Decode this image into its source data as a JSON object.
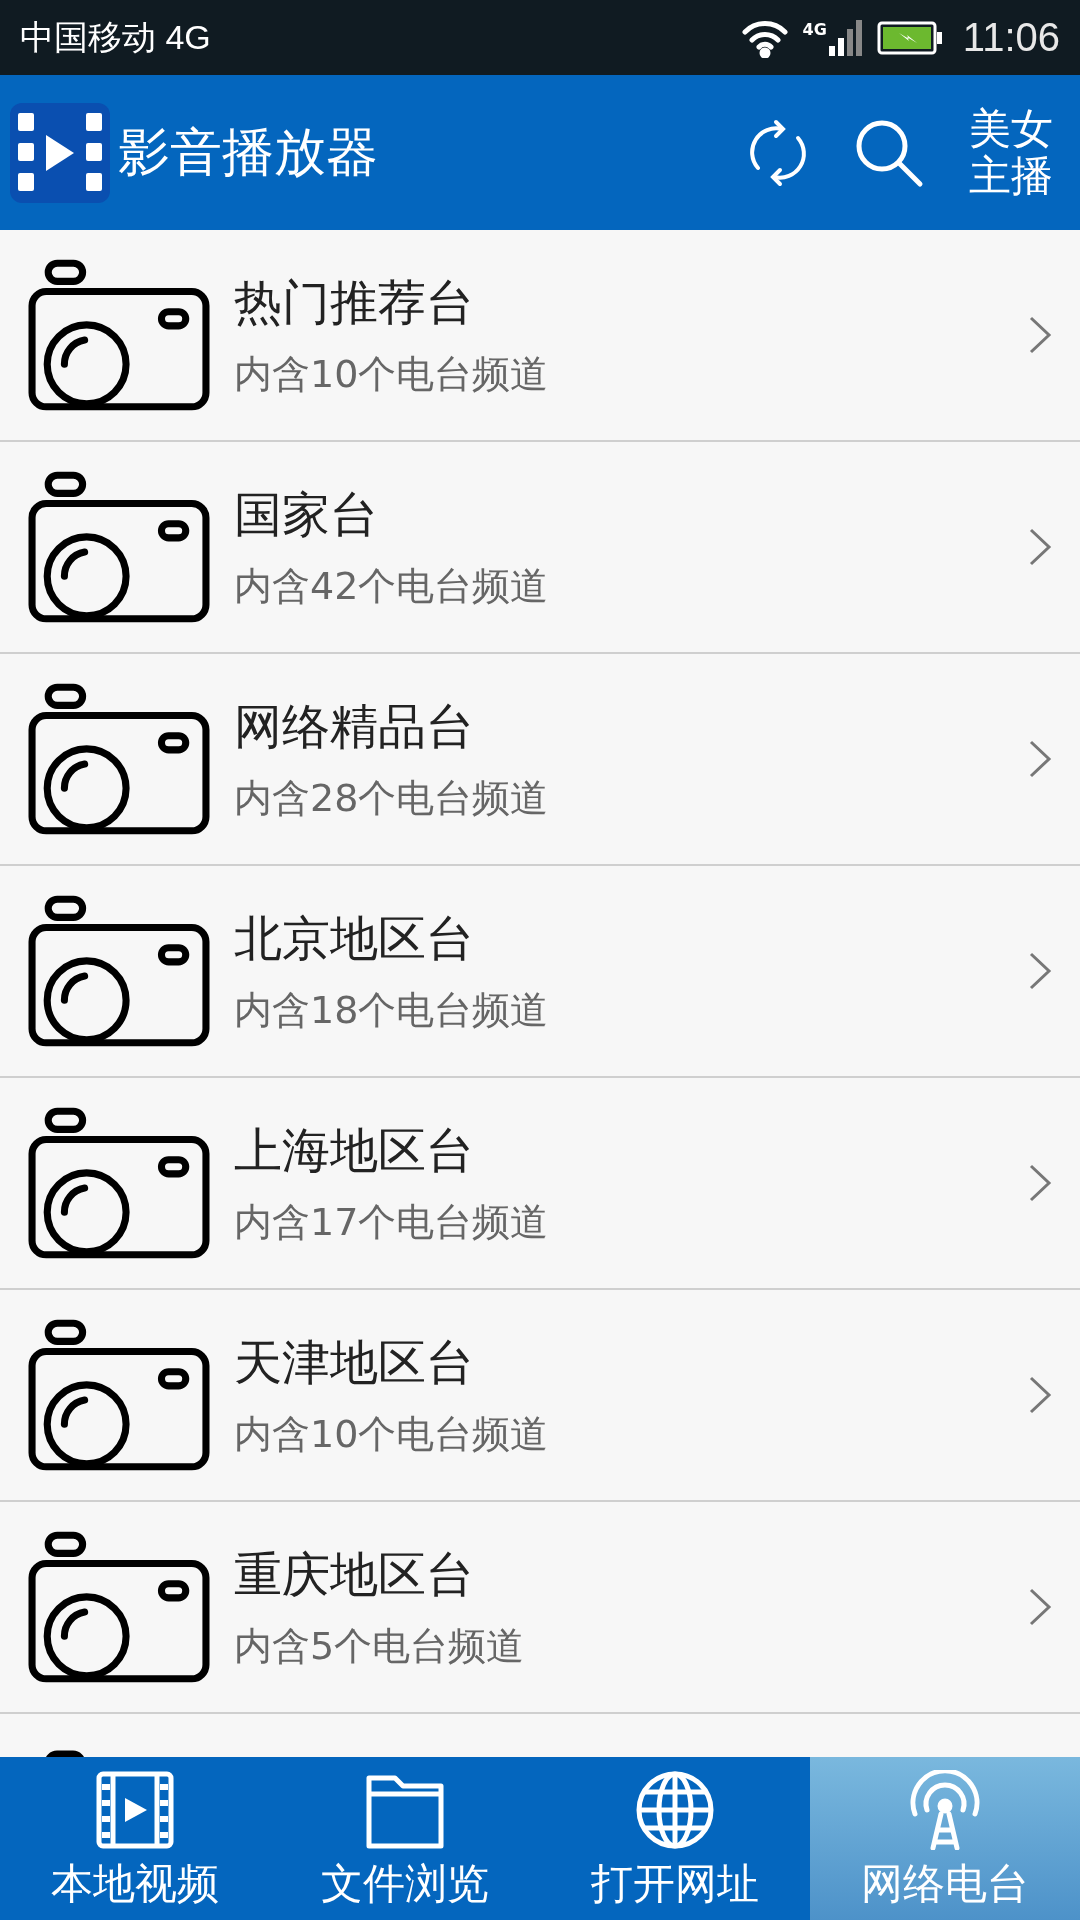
{
  "status_bar": {
    "carrier": "中国移动 4G",
    "network": "4G",
    "time": "11:06"
  },
  "app_bar": {
    "title": "影音播放器",
    "action_label": "美女主播"
  },
  "rows": [
    {
      "title": "热门推荐台",
      "subtitle": "内含10个电台频道"
    },
    {
      "title": "国家台",
      "subtitle": "内含42个电台频道"
    },
    {
      "title": "网络精品台",
      "subtitle": "内含28个电台频道"
    },
    {
      "title": "北京地区台",
      "subtitle": "内含18个电台频道"
    },
    {
      "title": "上海地区台",
      "subtitle": "内含17个电台频道"
    },
    {
      "title": "天津地区台",
      "subtitle": "内含10个电台频道"
    },
    {
      "title": "重庆地区台",
      "subtitle": "内含5个电台频道"
    }
  ],
  "tabs": [
    {
      "kind": "video",
      "label": "本地视频",
      "selected": false
    },
    {
      "kind": "folder",
      "label": "文件浏览",
      "selected": false
    },
    {
      "kind": "globe",
      "label": "打开网址",
      "selected": false
    },
    {
      "kind": "radio",
      "label": "网络电台",
      "selected": true
    }
  ]
}
